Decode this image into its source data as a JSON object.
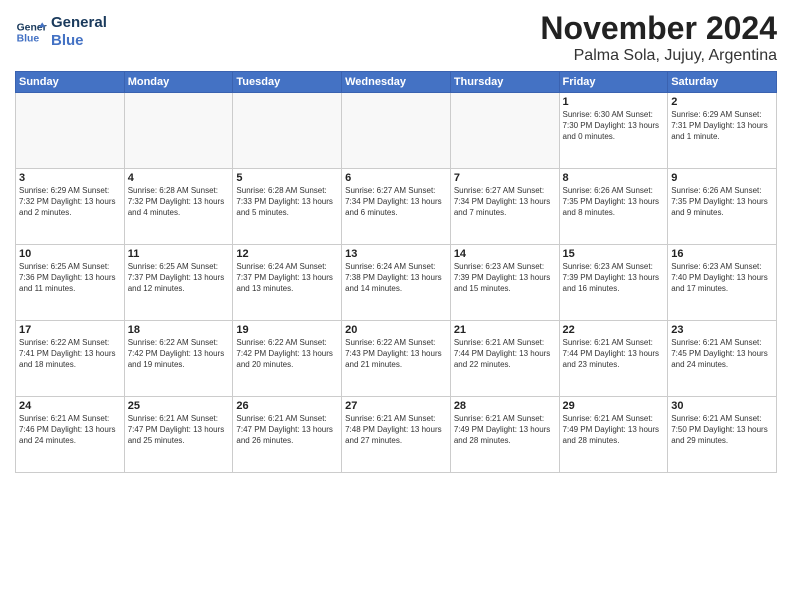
{
  "logo": {
    "line1": "General",
    "line2": "Blue"
  },
  "title": "November 2024",
  "location": "Palma Sola, Jujuy, Argentina",
  "days_of_week": [
    "Sunday",
    "Monday",
    "Tuesday",
    "Wednesday",
    "Thursday",
    "Friday",
    "Saturday"
  ],
  "weeks": [
    [
      {
        "day": "",
        "info": ""
      },
      {
        "day": "",
        "info": ""
      },
      {
        "day": "",
        "info": ""
      },
      {
        "day": "",
        "info": ""
      },
      {
        "day": "",
        "info": ""
      },
      {
        "day": "1",
        "info": "Sunrise: 6:30 AM\nSunset: 7:30 PM\nDaylight: 13 hours\nand 0 minutes."
      },
      {
        "day": "2",
        "info": "Sunrise: 6:29 AM\nSunset: 7:31 PM\nDaylight: 13 hours\nand 1 minute."
      }
    ],
    [
      {
        "day": "3",
        "info": "Sunrise: 6:29 AM\nSunset: 7:32 PM\nDaylight: 13 hours\nand 2 minutes."
      },
      {
        "day": "4",
        "info": "Sunrise: 6:28 AM\nSunset: 7:32 PM\nDaylight: 13 hours\nand 4 minutes."
      },
      {
        "day": "5",
        "info": "Sunrise: 6:28 AM\nSunset: 7:33 PM\nDaylight: 13 hours\nand 5 minutes."
      },
      {
        "day": "6",
        "info": "Sunrise: 6:27 AM\nSunset: 7:34 PM\nDaylight: 13 hours\nand 6 minutes."
      },
      {
        "day": "7",
        "info": "Sunrise: 6:27 AM\nSunset: 7:34 PM\nDaylight: 13 hours\nand 7 minutes."
      },
      {
        "day": "8",
        "info": "Sunrise: 6:26 AM\nSunset: 7:35 PM\nDaylight: 13 hours\nand 8 minutes."
      },
      {
        "day": "9",
        "info": "Sunrise: 6:26 AM\nSunset: 7:35 PM\nDaylight: 13 hours\nand 9 minutes."
      }
    ],
    [
      {
        "day": "10",
        "info": "Sunrise: 6:25 AM\nSunset: 7:36 PM\nDaylight: 13 hours\nand 11 minutes."
      },
      {
        "day": "11",
        "info": "Sunrise: 6:25 AM\nSunset: 7:37 PM\nDaylight: 13 hours\nand 12 minutes."
      },
      {
        "day": "12",
        "info": "Sunrise: 6:24 AM\nSunset: 7:37 PM\nDaylight: 13 hours\nand 13 minutes."
      },
      {
        "day": "13",
        "info": "Sunrise: 6:24 AM\nSunset: 7:38 PM\nDaylight: 13 hours\nand 14 minutes."
      },
      {
        "day": "14",
        "info": "Sunrise: 6:23 AM\nSunset: 7:39 PM\nDaylight: 13 hours\nand 15 minutes."
      },
      {
        "day": "15",
        "info": "Sunrise: 6:23 AM\nSunset: 7:39 PM\nDaylight: 13 hours\nand 16 minutes."
      },
      {
        "day": "16",
        "info": "Sunrise: 6:23 AM\nSunset: 7:40 PM\nDaylight: 13 hours\nand 17 minutes."
      }
    ],
    [
      {
        "day": "17",
        "info": "Sunrise: 6:22 AM\nSunset: 7:41 PM\nDaylight: 13 hours\nand 18 minutes."
      },
      {
        "day": "18",
        "info": "Sunrise: 6:22 AM\nSunset: 7:42 PM\nDaylight: 13 hours\nand 19 minutes."
      },
      {
        "day": "19",
        "info": "Sunrise: 6:22 AM\nSunset: 7:42 PM\nDaylight: 13 hours\nand 20 minutes."
      },
      {
        "day": "20",
        "info": "Sunrise: 6:22 AM\nSunset: 7:43 PM\nDaylight: 13 hours\nand 21 minutes."
      },
      {
        "day": "21",
        "info": "Sunrise: 6:21 AM\nSunset: 7:44 PM\nDaylight: 13 hours\nand 22 minutes."
      },
      {
        "day": "22",
        "info": "Sunrise: 6:21 AM\nSunset: 7:44 PM\nDaylight: 13 hours\nand 23 minutes."
      },
      {
        "day": "23",
        "info": "Sunrise: 6:21 AM\nSunset: 7:45 PM\nDaylight: 13 hours\nand 24 minutes."
      }
    ],
    [
      {
        "day": "24",
        "info": "Sunrise: 6:21 AM\nSunset: 7:46 PM\nDaylight: 13 hours\nand 24 minutes."
      },
      {
        "day": "25",
        "info": "Sunrise: 6:21 AM\nSunset: 7:47 PM\nDaylight: 13 hours\nand 25 minutes."
      },
      {
        "day": "26",
        "info": "Sunrise: 6:21 AM\nSunset: 7:47 PM\nDaylight: 13 hours\nand 26 minutes."
      },
      {
        "day": "27",
        "info": "Sunrise: 6:21 AM\nSunset: 7:48 PM\nDaylight: 13 hours\nand 27 minutes."
      },
      {
        "day": "28",
        "info": "Sunrise: 6:21 AM\nSunset: 7:49 PM\nDaylight: 13 hours\nand 28 minutes."
      },
      {
        "day": "29",
        "info": "Sunrise: 6:21 AM\nSunset: 7:49 PM\nDaylight: 13 hours\nand 28 minutes."
      },
      {
        "day": "30",
        "info": "Sunrise: 6:21 AM\nSunset: 7:50 PM\nDaylight: 13 hours\nand 29 minutes."
      }
    ]
  ]
}
